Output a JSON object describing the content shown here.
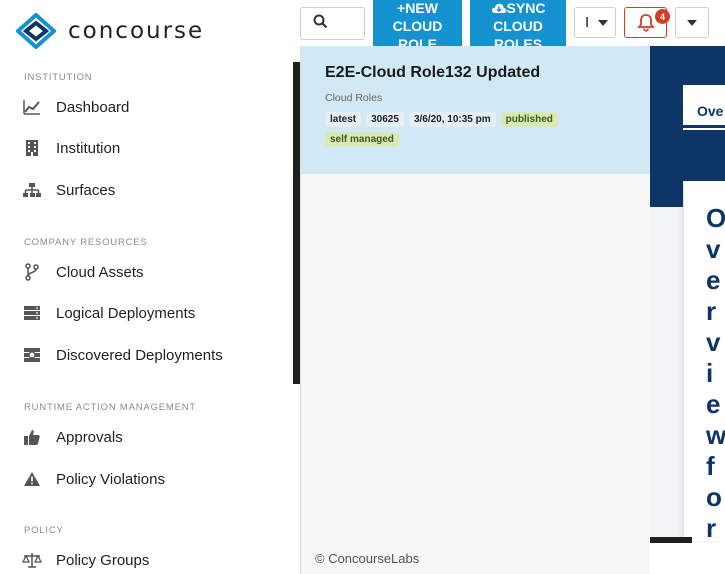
{
  "app": {
    "name": "concourse"
  },
  "colors": {
    "accent": "#1592d0",
    "navy": "#0d3566",
    "alert": "#d63b25",
    "selected_row": "#d1e9f5"
  },
  "sidebar": {
    "sections": [
      {
        "label": "INSTITUTION",
        "items": [
          {
            "label": "Dashboard",
            "icon": "chart-line-icon"
          },
          {
            "label": "Institution",
            "icon": "building-icon"
          },
          {
            "label": "Surfaces",
            "icon": "sitemap-icon"
          }
        ]
      },
      {
        "label": "COMPANY RESOURCES",
        "items": [
          {
            "label": "Cloud Assets",
            "icon": "code-branch-icon"
          },
          {
            "label": "Logical Deployments",
            "icon": "server-icon"
          },
          {
            "label": "Discovered Deployments",
            "icon": "search-server-icon"
          }
        ]
      },
      {
        "label": "RUNTIME ACTION MANAGEMENT",
        "items": [
          {
            "label": "Approvals",
            "icon": "thumbs-up-icon"
          },
          {
            "label": "Policy Violations",
            "icon": "warning-icon"
          }
        ]
      },
      {
        "label": "POLICY",
        "items": [
          {
            "label": "Policy Groups",
            "icon": "balance-scale-icon"
          }
        ]
      }
    ]
  },
  "toolbar": {
    "new_button": {
      "line1": "NEW",
      "line2": "CLOUD",
      "line3": "ROLE"
    },
    "sync_button": {
      "line1": "SYNC",
      "line2": "CLOUD",
      "line3": "ROLES"
    },
    "dropdown_value": "I",
    "notification_count": "4"
  },
  "list": {
    "selected": {
      "title": "E2E-Cloud Role132 Updated",
      "subtitle": "Cloud Roles",
      "tags": [
        "latest",
        "30625",
        "3/6/20, 10:35 pm"
      ],
      "status_tags": [
        "published",
        "self managed"
      ]
    }
  },
  "detail": {
    "tab": "Ove",
    "heading": "Overviewfor"
  },
  "footer": {
    "text": "© ConcourseLabs"
  }
}
